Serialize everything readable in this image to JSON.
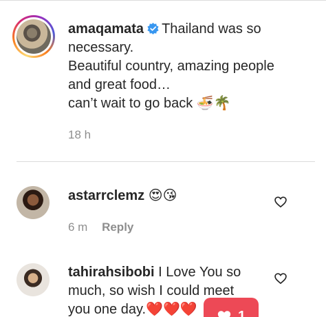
{
  "caption": {
    "username": "amaqamata",
    "lines": [
      "Thailand was so",
      "necessary.",
      "Beautiful country, amazing people",
      "and great food…",
      "can’t wait to go back 🍜🌴"
    ],
    "time": "18 h"
  },
  "comments": [
    {
      "username": "astarrclemz",
      "text": "😍😘",
      "time": "6 m",
      "reply_label": "Reply"
    },
    {
      "username": "tahirahsibobi",
      "lines": [
        "I Love You so",
        "much, so wish I could meet",
        "you one day.❤️❤️❤️"
      ]
    }
  ],
  "like_badge": {
    "count": "1"
  },
  "colors": {
    "accent": "#ed4956",
    "verified": "#3897f0",
    "muted": "#8e8e8e"
  },
  "icons": [
    "verified-badge-icon",
    "heart-outline-icon",
    "heart-filled-icon"
  ]
}
